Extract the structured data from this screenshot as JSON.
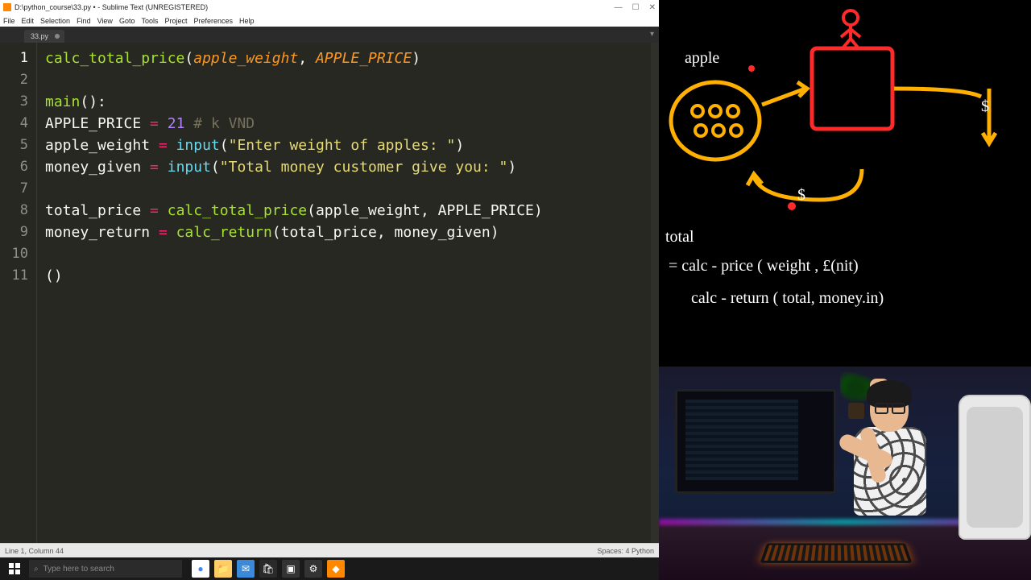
{
  "window": {
    "title": "D:\\python_course\\33.py • - Sublime Text (UNREGISTERED)",
    "menu": [
      "File",
      "Edit",
      "Selection",
      "Find",
      "View",
      "Goto",
      "Tools",
      "Project",
      "Preferences",
      "Help"
    ],
    "tab_name": "33.py",
    "status_left": "Line 1, Column 44",
    "status_right": "Spaces: 4    Python"
  },
  "code": {
    "lines": [
      {
        "n": "1",
        "seg": [
          [
            "fn",
            "calc_total_price"
          ],
          [
            "pn",
            "("
          ],
          [
            "param",
            "apple_weight"
          ],
          [
            "pn",
            ", "
          ],
          [
            "param",
            "APPLE_PRICE"
          ],
          [
            "pn",
            ")"
          ]
        ]
      },
      {
        "n": "2",
        "seg": []
      },
      {
        "n": "3",
        "seg": [
          [
            "fn",
            "main"
          ],
          [
            "pn",
            "():"
          ]
        ]
      },
      {
        "n": "4",
        "seg": [
          [
            "pn",
            "APPLE_PRICE "
          ],
          [
            "op",
            "="
          ],
          [
            "pn",
            " "
          ],
          [
            "num",
            "21"
          ],
          [
            "pn",
            " "
          ],
          [
            "cm",
            "# k VND"
          ]
        ]
      },
      {
        "n": "5",
        "seg": [
          [
            "pn",
            "apple_weight "
          ],
          [
            "op",
            "="
          ],
          [
            "pn",
            " "
          ],
          [
            "kw",
            "input"
          ],
          [
            "pn",
            "("
          ],
          [
            "str",
            "\"Enter weight of apples: \""
          ],
          [
            "pn",
            ")"
          ]
        ]
      },
      {
        "n": "6",
        "seg": [
          [
            "pn",
            "money_given "
          ],
          [
            "op",
            "="
          ],
          [
            "pn",
            " "
          ],
          [
            "kw",
            "input"
          ],
          [
            "pn",
            "("
          ],
          [
            "str",
            "\"Total money customer give you: \""
          ],
          [
            "pn",
            ")"
          ]
        ]
      },
      {
        "n": "7",
        "seg": []
      },
      {
        "n": "8",
        "seg": [
          [
            "pn",
            "total_price "
          ],
          [
            "op",
            "="
          ],
          [
            "pn",
            " "
          ],
          [
            "fn",
            "calc_total_price"
          ],
          [
            "pn",
            "(apple_weight, APPLE_PRICE)"
          ]
        ]
      },
      {
        "n": "9",
        "seg": [
          [
            "pn",
            "money_return "
          ],
          [
            "op",
            "="
          ],
          [
            "pn",
            " "
          ],
          [
            "fn",
            "calc_return"
          ],
          [
            "pn",
            "(total_price, money_given)"
          ]
        ]
      },
      {
        "n": "10",
        "seg": []
      },
      {
        "n": "11",
        "seg": [
          [
            "pn",
            "()"
          ]
        ]
      }
    ],
    "current_line": 1
  },
  "taskbar": {
    "search_placeholder": "Type here to search",
    "icons": [
      "chrome",
      "files",
      "mail",
      "store",
      "terminal",
      "settings",
      "sublime"
    ]
  },
  "whiteboard": {
    "label_apple": "apple",
    "label_total": "total",
    "line1": "= calc - price ( weight , £(nit)",
    "line2": "calc - return ( total, money.in)",
    "dollar": "$"
  }
}
